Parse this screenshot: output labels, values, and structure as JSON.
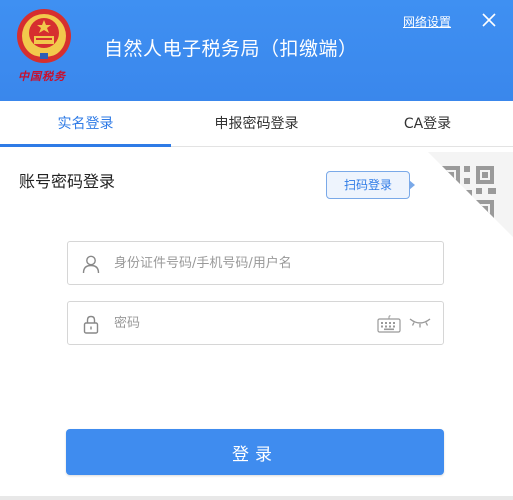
{
  "header": {
    "title": "自然人电子税务局（扣缴端）",
    "logo_text": "中国税务",
    "network_settings_label": "网络设置",
    "close_icon": "close-icon",
    "emblem_icon": "tax-emblem-icon",
    "background_color": "#3d8ef0"
  },
  "tabs": [
    {
      "label": "实名登录",
      "active": true
    },
    {
      "label": "申报密码登录",
      "active": false
    },
    {
      "label": "CA登录",
      "active": false
    }
  ],
  "login": {
    "section_title": "账号密码登录",
    "scan_button_label": "扫码登录",
    "qr_icon": "qr-code-icon",
    "username": {
      "placeholder": "身份证件号码/手机号码/用户名",
      "value": "",
      "icon": "user-icon"
    },
    "password": {
      "placeholder": "密码",
      "value": "",
      "icon": "lock-icon",
      "keyboard_icon": "keyboard-icon",
      "eye_icon": "eye-closed-icon"
    },
    "submit_label": "登录",
    "accent_color": "#2f7be6"
  }
}
